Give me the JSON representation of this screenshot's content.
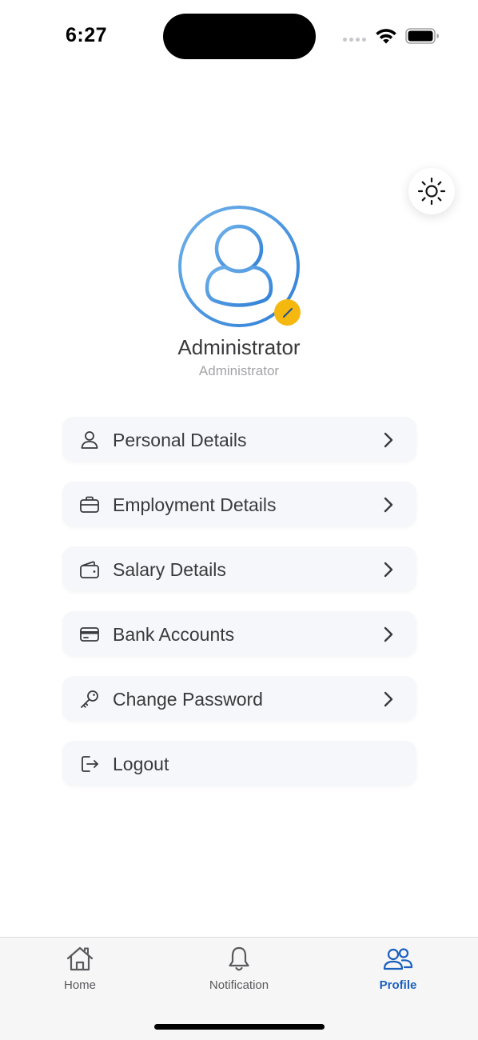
{
  "status_bar": {
    "time": "6:27"
  },
  "profile": {
    "name": "Administrator",
    "role": "Administrator"
  },
  "menu": {
    "items": [
      {
        "label": "Personal Details",
        "icon": "person-icon",
        "has_chevron": true
      },
      {
        "label": "Employment Details",
        "icon": "briefcase-icon",
        "has_chevron": true
      },
      {
        "label": "Salary Details",
        "icon": "wallet-icon",
        "has_chevron": true
      },
      {
        "label": "Bank Accounts",
        "icon": "credit-card-icon",
        "has_chevron": true
      },
      {
        "label": "Change Password",
        "icon": "key-icon",
        "has_chevron": true
      },
      {
        "label": "Logout",
        "icon": "logout-icon",
        "has_chevron": false
      }
    ]
  },
  "tabs": [
    {
      "label": "Home",
      "icon": "home-icon",
      "active": false
    },
    {
      "label": "Notification",
      "icon": "bell-icon",
      "active": false
    },
    {
      "label": "Profile",
      "icon": "users-icon",
      "active": true
    }
  ],
  "colors": {
    "accent": "#1a5fbf",
    "avatar_ring": "#3b8de0",
    "edit_badge": "#f5b80f",
    "menu_background": "#f5f7fa"
  }
}
